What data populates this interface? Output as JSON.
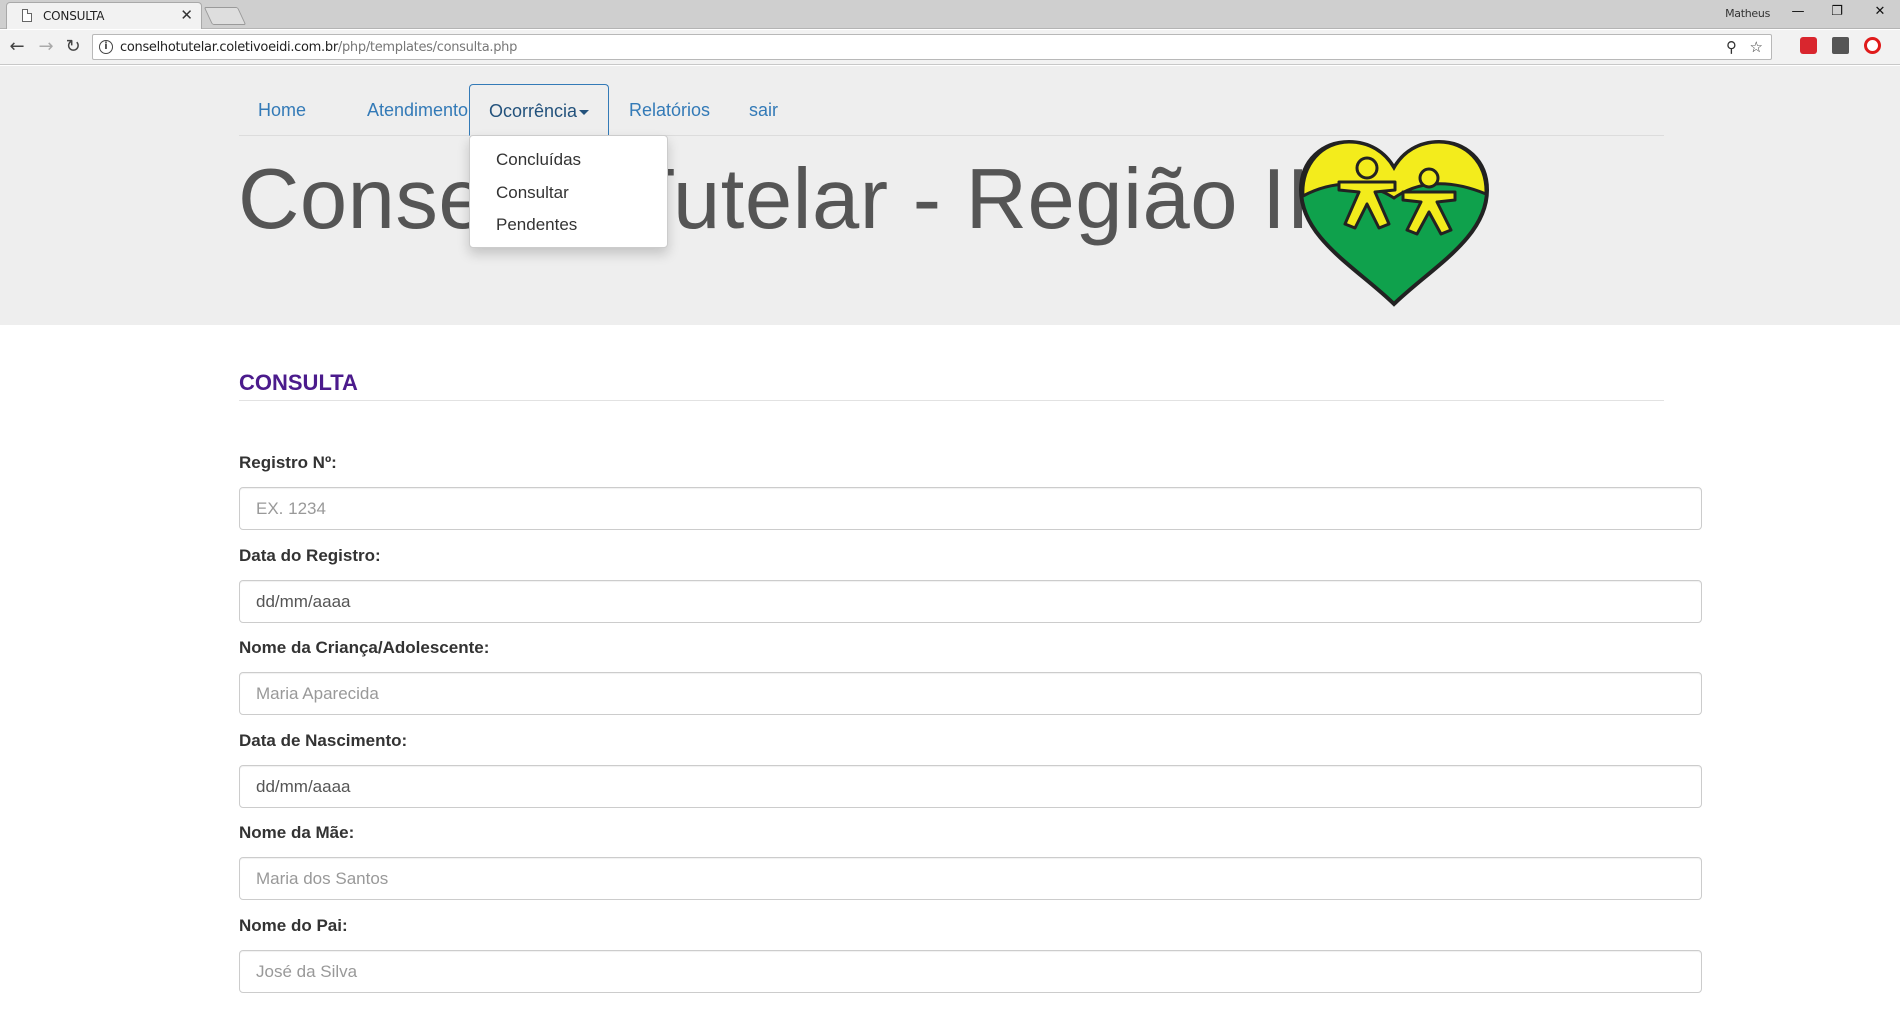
{
  "browser": {
    "tab_title": "CONSULTA",
    "tab_close": "✕",
    "profile_name": "Matheus",
    "url_host": "conselhotutelar.coletivoeidi.com.br",
    "url_path": "/php/templates/consulta.php",
    "window_minimize": "—",
    "window_restore": "❐",
    "window_close": "✕",
    "back": "←",
    "forward": "→",
    "reload": "↻",
    "zoom_icon": "⚲",
    "star_icon": "☆"
  },
  "nav": {
    "items": [
      {
        "label": "Home"
      },
      {
        "label": "Atendimento"
      },
      {
        "label": "Ocorrência"
      },
      {
        "label": "Relatórios"
      },
      {
        "label": "sair"
      }
    ]
  },
  "dropdown": {
    "items": [
      {
        "label": "Concluídas"
      },
      {
        "label": "Consultar"
      },
      {
        "label": "Pendentes"
      }
    ]
  },
  "header": {
    "title": "Conselho Tutelar - Região II"
  },
  "section": {
    "title": "CONSULTA"
  },
  "form": {
    "fields": [
      {
        "label": "Registro Nº:",
        "placeholder": "EX. 1234",
        "value": ""
      },
      {
        "label": "Data do Registro:",
        "placeholder": "",
        "value": "dd/mm/aaaa"
      },
      {
        "label": "Nome da Criança/Adolescente:",
        "placeholder": "Maria Aparecida",
        "value": ""
      },
      {
        "label": "Data de Nascimento:",
        "placeholder": "",
        "value": "dd/mm/aaaa"
      },
      {
        "label": "Nome da Mãe:",
        "placeholder": "Maria dos Santos",
        "value": ""
      },
      {
        "label": "Nome do Pai:",
        "placeholder": "José da Silva",
        "value": ""
      }
    ]
  },
  "colors": {
    "link": "#337ab7",
    "section_title": "#4b1b8c",
    "logo_green": "#0fa14c",
    "logo_yellow": "#f3ec1c"
  }
}
